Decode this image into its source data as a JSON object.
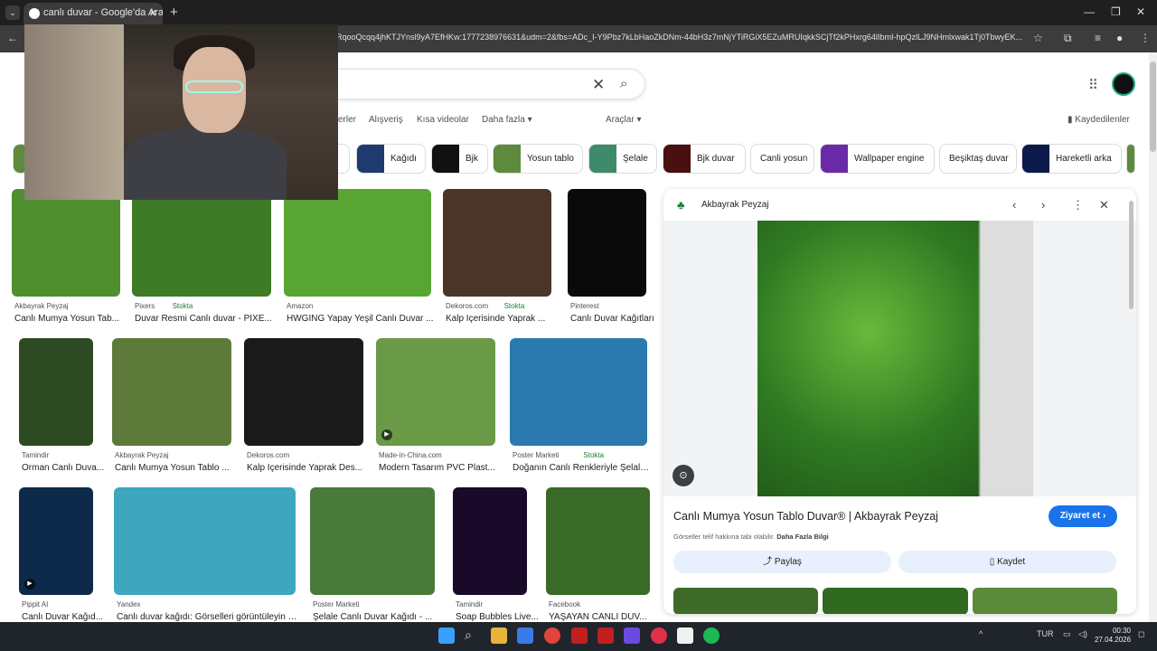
{
  "browser": {
    "tab_title": "canlı duvar - Google'da Ara",
    "url": "RqooQcqq4jhKTJYnsl9yA7EfHKw:1777238976631&udm=2&fbs=ADc_I-Y9Pbz7kLbHaoZkDNm-44bH3z7mNjYTiRGiX5EZuMRUIqkkSCjTf2kPHxrg64lIbmI-hpQzlLJ9NHmlxwak1Tj0TbwyEK..."
  },
  "filters": [
    "erler",
    "Alışveriş",
    "Kısa videolar",
    "Daha fazla ▾",
    "Araçlar ▾"
  ],
  "saved_label": "Kaydedilenler",
  "chips": [
    {
      "label": "ş",
      "color": "#6b8a4a"
    },
    {
      "label": "Kağıdı",
      "color": "#1e3a6e"
    },
    {
      "label": "Bjk",
      "color": "#111111"
    },
    {
      "label": "Yosun tablo",
      "color": "#5d8a3c"
    },
    {
      "label": "Şelale",
      "color": "#3f8a6a"
    },
    {
      "label": "Bjk duvar",
      "color": "#4a0f0f"
    },
    {
      "label": "Canli yosun",
      "color": ""
    },
    {
      "label": "Wallpaper engine",
      "color": "#6a2aa8"
    },
    {
      "label": "Beşiktaş duvar",
      "color": ""
    },
    {
      "label": "Hareketli arka",
      "color": "#0b1a4a"
    }
  ],
  "results": [
    {
      "source": "Akbayrak Peyzaj",
      "stock": "",
      "title": "Canlı Mumya Yosun Tab...",
      "color": "#4f8f2f",
      "video": false
    },
    {
      "source": "Pixers",
      "stock": "Stokta",
      "title": "Duvar Resmi Canlı duvar - PIXE...",
      "color": "#3f7a26",
      "video": false
    },
    {
      "source": "Amazon",
      "stock": "",
      "title": "HWGING Yapay Yeşil Canlı Duvar ...",
      "color": "#58a533",
      "video": false
    },
    {
      "source": "Dekoros.com",
      "stock": "Stokta",
      "title": "Kalp İçerisinde Yaprak ...",
      "color": "#4a3528",
      "video": false
    },
    {
      "source": "Pinterest",
      "stock": "",
      "title": "Canlı Duvar Kağıtları",
      "color": "#0a0a0a",
      "video": false
    },
    {
      "source": "Tamindir",
      "stock": "",
      "title": "Orman Canlı Duva...",
      "color": "#2d4a22",
      "video": false
    },
    {
      "source": "Akbayrak Peyzaj",
      "stock": "",
      "title": "Canlı Mumya Yosun Tablo ...",
      "color": "#5e7a3a",
      "video": false
    },
    {
      "source": "Dekoros.com",
      "stock": "",
      "title": "Kalp İçerisinde Yaprak Des...",
      "color": "#1a1a1a",
      "video": false
    },
    {
      "source": "Made-in-China.com",
      "stock": "",
      "title": "Modern Tasarım PVC Plast...",
      "color": "#6a9a48",
      "video": true
    },
    {
      "source": "Poster Marketi",
      "stock": "Stokta",
      "title": "Doğanın Canlı Renkleriyle Şelale ...",
      "color": "#2a7ab0",
      "video": false
    },
    {
      "source": "Pippit AI",
      "stock": "",
      "title": "Canlı Duvar Kağıd...",
      "color": "#0d2a4a",
      "video": true
    },
    {
      "source": "Yandex",
      "stock": "",
      "title": "Canlı duvar kağıdı: Görselleri görüntüleyin v...",
      "color": "#3fa6c0",
      "video": false
    },
    {
      "source": "Poster Marketi",
      "stock": "",
      "title": "Şelale Canlı Duvar Kağıdı - ...",
      "color": "#4a7a3a",
      "video": false
    },
    {
      "source": "Tamindir",
      "stock": "",
      "title": "Soap Bubbles Live...",
      "color": "#1a0a2a",
      "video": false
    },
    {
      "source": "Facebook",
      "stock": "",
      "title": "YAŞAYAN CANLI DUV...",
      "color": "#3a6a28",
      "video": false
    }
  ],
  "panel": {
    "source": "Akbayrak Peyzaj",
    "title": "Canlı Mumya Yosun Tablo Duvar® | Akbayrak Peyzaj",
    "visit": "Ziyaret et",
    "note": "Görseller telif hakkına tabi olabilir.",
    "note_link": "Daha Fazla Bilgi",
    "share": "Paylaş",
    "save": "Kaydet"
  },
  "taskbar": {
    "lang": "TUR",
    "time": "00:30",
    "date": "27.04.2026"
  },
  "icons": [
    "search-icon",
    "close-icon",
    "apps-icon",
    "chevron-left-icon",
    "chevron-right-icon",
    "more-icon",
    "lens-icon",
    "share-icon",
    "bookmark-icon"
  ]
}
